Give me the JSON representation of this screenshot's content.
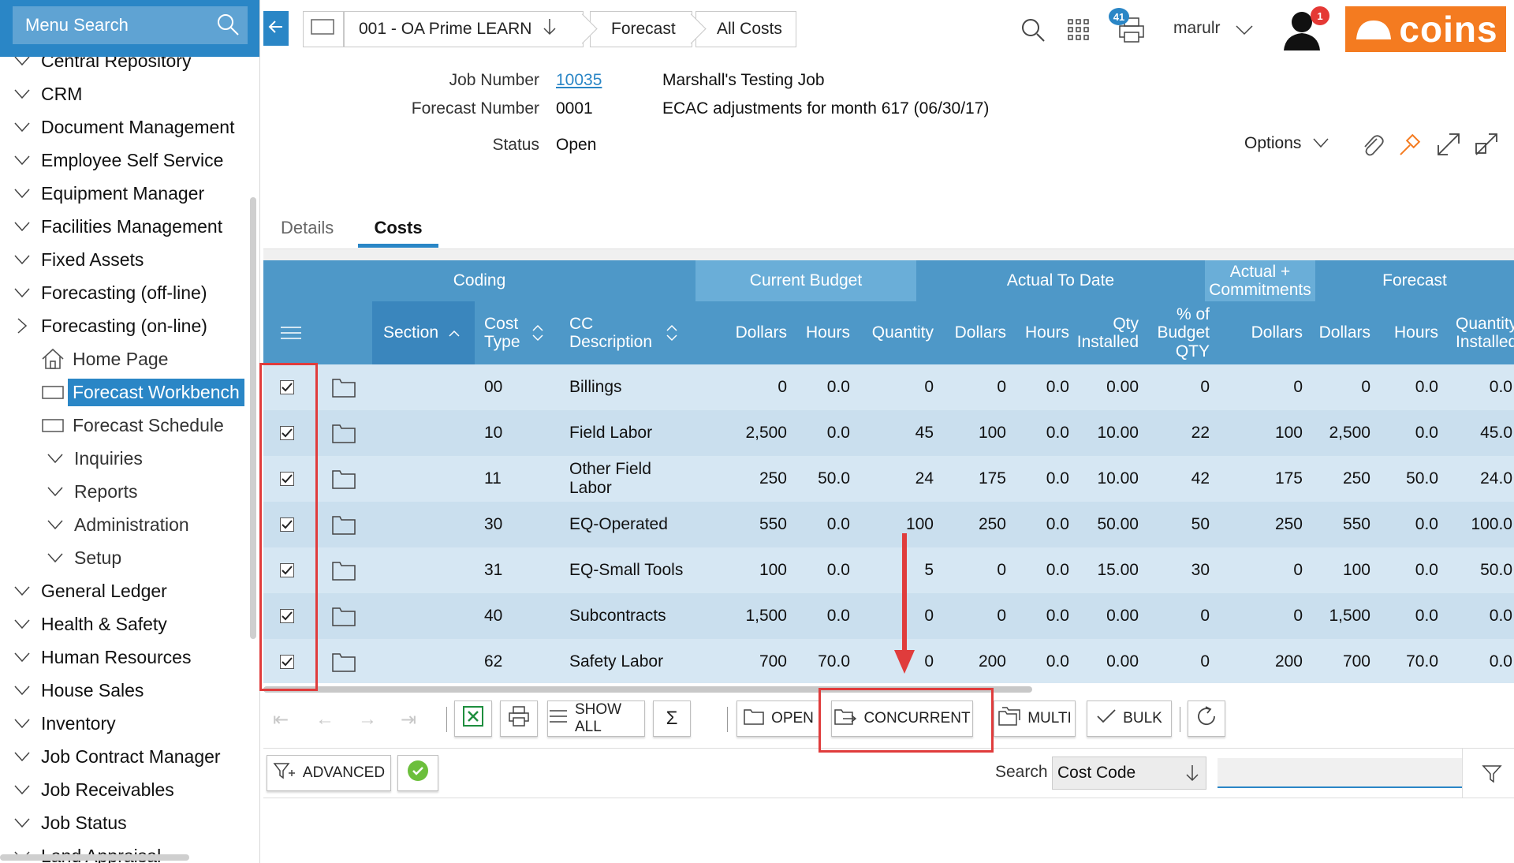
{
  "sidebar": {
    "search_label": "Menu Search",
    "items": [
      {
        "label": "Central Repository",
        "level": 0,
        "icon": "chevron-down"
      },
      {
        "label": "CRM",
        "level": 0,
        "icon": "chevron-down"
      },
      {
        "label": "Document Management",
        "level": 0,
        "icon": "chevron-down"
      },
      {
        "label": "Employee Self Service",
        "level": 0,
        "icon": "chevron-down"
      },
      {
        "label": "Equipment Manager",
        "level": 0,
        "icon": "chevron-down"
      },
      {
        "label": "Facilities Management",
        "level": 0,
        "icon": "chevron-down"
      },
      {
        "label": "Fixed Assets",
        "level": 0,
        "icon": "chevron-down"
      },
      {
        "label": "Forecasting (off-line)",
        "level": 0,
        "icon": "chevron-down"
      },
      {
        "label": "Forecasting (on-line)",
        "level": 0,
        "icon": "chevron-right"
      },
      {
        "label": "Home Page",
        "level": 1,
        "icon": "home"
      },
      {
        "label": "Forecast Workbench",
        "level": 1,
        "icon": "page",
        "active": true
      },
      {
        "label": "Forecast Schedule",
        "level": 1,
        "icon": "page"
      },
      {
        "label": "Inquiries",
        "level": 1,
        "icon": "chevron-down"
      },
      {
        "label": "Reports",
        "level": 1,
        "icon": "chevron-down"
      },
      {
        "label": "Administration",
        "level": 1,
        "icon": "chevron-down"
      },
      {
        "label": "Setup",
        "level": 1,
        "icon": "chevron-down"
      },
      {
        "label": "General Ledger",
        "level": 0,
        "icon": "chevron-down"
      },
      {
        "label": "Health & Safety",
        "level": 0,
        "icon": "chevron-down"
      },
      {
        "label": "Human Resources",
        "level": 0,
        "icon": "chevron-down"
      },
      {
        "label": "House Sales",
        "level": 0,
        "icon": "chevron-down"
      },
      {
        "label": "Inventory",
        "level": 0,
        "icon": "chevron-down"
      },
      {
        "label": "Job Contract Manager",
        "level": 0,
        "icon": "chevron-down"
      },
      {
        "label": "Job Receivables",
        "level": 0,
        "icon": "chevron-down"
      },
      {
        "label": "Job Status",
        "level": 0,
        "icon": "chevron-down"
      },
      {
        "label": "Land Appraisal",
        "level": 0,
        "icon": "chevron-down"
      }
    ]
  },
  "topbar": {
    "breadcrumbs": [
      "001 - OA Prime LEARN",
      "Forecast",
      "All Costs"
    ],
    "print_badge": "41",
    "user_name": "marulr",
    "alert_badge": "1",
    "logo_text": "coins",
    "logo_color": "#f47b20",
    "accent_color": "#2a86c6"
  },
  "header": {
    "job_number_label": "Job Number",
    "job_number": "10035",
    "job_name": "Marshall's Testing Job",
    "forecast_number_label": "Forecast Number",
    "forecast_number": "0001",
    "forecast_description": "ECAC adjustments for month 617 (06/30/17)",
    "status_label": "Status",
    "status": "Open",
    "options_label": "Options"
  },
  "tabs": [
    {
      "label": "Details",
      "active": false
    },
    {
      "label": "Costs",
      "active": true
    }
  ],
  "grid": {
    "groups": [
      "Coding",
      "Current Budget",
      "Actual To Date",
      "Actual + Commitments",
      "Forecast"
    ],
    "columns": [
      "Section",
      "Cost Type",
      "CC Description",
      "Dollars",
      "Hours",
      "Quantity",
      "Dollars",
      "Hours",
      "Qty Installed",
      "% of Budget QTY",
      "Dollars",
      "Dollars",
      "Hours",
      "Quantity Installed"
    ],
    "rows": [
      {
        "cost_type": "00",
        "description": "Billings",
        "vals": [
          "0",
          "0.0",
          "0",
          "0",
          "0.0",
          "0.00",
          "0",
          "0",
          "0",
          "0.0",
          "0.0"
        ]
      },
      {
        "cost_type": "10",
        "description": "Field Labor",
        "vals": [
          "2,500",
          "0.0",
          "45",
          "100",
          "0.0",
          "10.00",
          "22",
          "100",
          "2,500",
          "0.0",
          "45.0"
        ]
      },
      {
        "cost_type": "11",
        "description": "Other Field Labor",
        "vals": [
          "250",
          "50.0",
          "24",
          "175",
          "0.0",
          "10.00",
          "42",
          "175",
          "250",
          "50.0",
          "24.0"
        ]
      },
      {
        "cost_type": "30",
        "description": "EQ-Operated",
        "vals": [
          "550",
          "0.0",
          "100",
          "250",
          "0.0",
          "50.00",
          "50",
          "250",
          "550",
          "0.0",
          "100.0"
        ]
      },
      {
        "cost_type": "31",
        "description": "EQ-Small Tools",
        "vals": [
          "100",
          "0.0",
          "5",
          "0",
          "0.0",
          "15.00",
          "30",
          "0",
          "100",
          "0.0",
          "50.0"
        ]
      },
      {
        "cost_type": "40",
        "description": "Subcontracts",
        "vals": [
          "1,500",
          "0.0",
          "0",
          "0",
          "0.0",
          "0.00",
          "0",
          "0",
          "1,500",
          "0.0",
          "0.0"
        ]
      },
      {
        "cost_type": "62",
        "description": "Safety Labor",
        "vals": [
          "700",
          "70.0",
          "0",
          "200",
          "0.0",
          "0.00",
          "0",
          "200",
          "700",
          "70.0",
          "0.0"
        ]
      }
    ]
  },
  "toolbar": {
    "show_all": "SHOW ALL",
    "open": "OPEN",
    "concurrent": "CONCURRENT",
    "multi": "MULTI",
    "bulk": "BULK",
    "advanced": "ADVANCED"
  },
  "search": {
    "label": "Search",
    "field": "Cost Code",
    "value": ""
  }
}
